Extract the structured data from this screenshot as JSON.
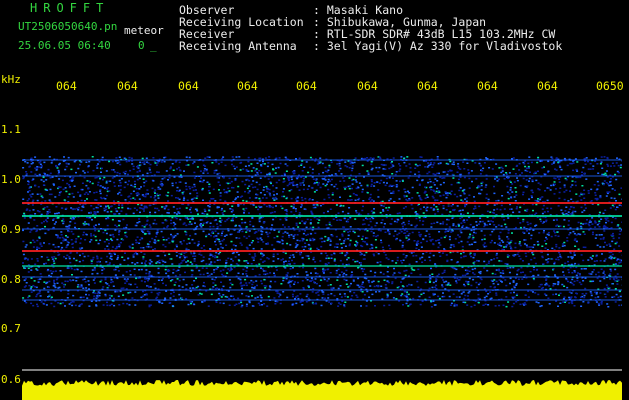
{
  "header": {
    "logo": "HROFFT",
    "filename": "UT2506050640.pn",
    "mode": "meteor",
    "datetime": "25.06.05 06:40",
    "count": "0",
    "extra": "_",
    "labels": [
      "Observer",
      "Receiving Location",
      "Receiver",
      "Receiving Antenna"
    ],
    "values": [
      ": Masaki Kano",
      ": Shibukawa, Gunma, Japan",
      ": RTL-SDR SDR# 43dB L15 103.2MHz CW",
      ": 3el Yagi(V) Az 330 for Vladivostok"
    ]
  },
  "spectrogram": {
    "unit": "kHz",
    "y_ticks": [
      "1.1",
      "1.0",
      "0.9",
      "0.8",
      "0.7",
      "0.6"
    ],
    "x_ticks": [
      "064",
      "064",
      "064",
      "064",
      "064",
      "064",
      "064",
      "064",
      "064",
      "0650"
    ],
    "colors": {
      "background": "#000000",
      "noise_low": "#0a1ea0",
      "noise_mid": "#1e64ff",
      "signal": "#00e0a0",
      "peak": "#ff2020",
      "axis_text": "#f0f000",
      "header_green": "#33d640",
      "header_white": "#ececec"
    }
  }
}
